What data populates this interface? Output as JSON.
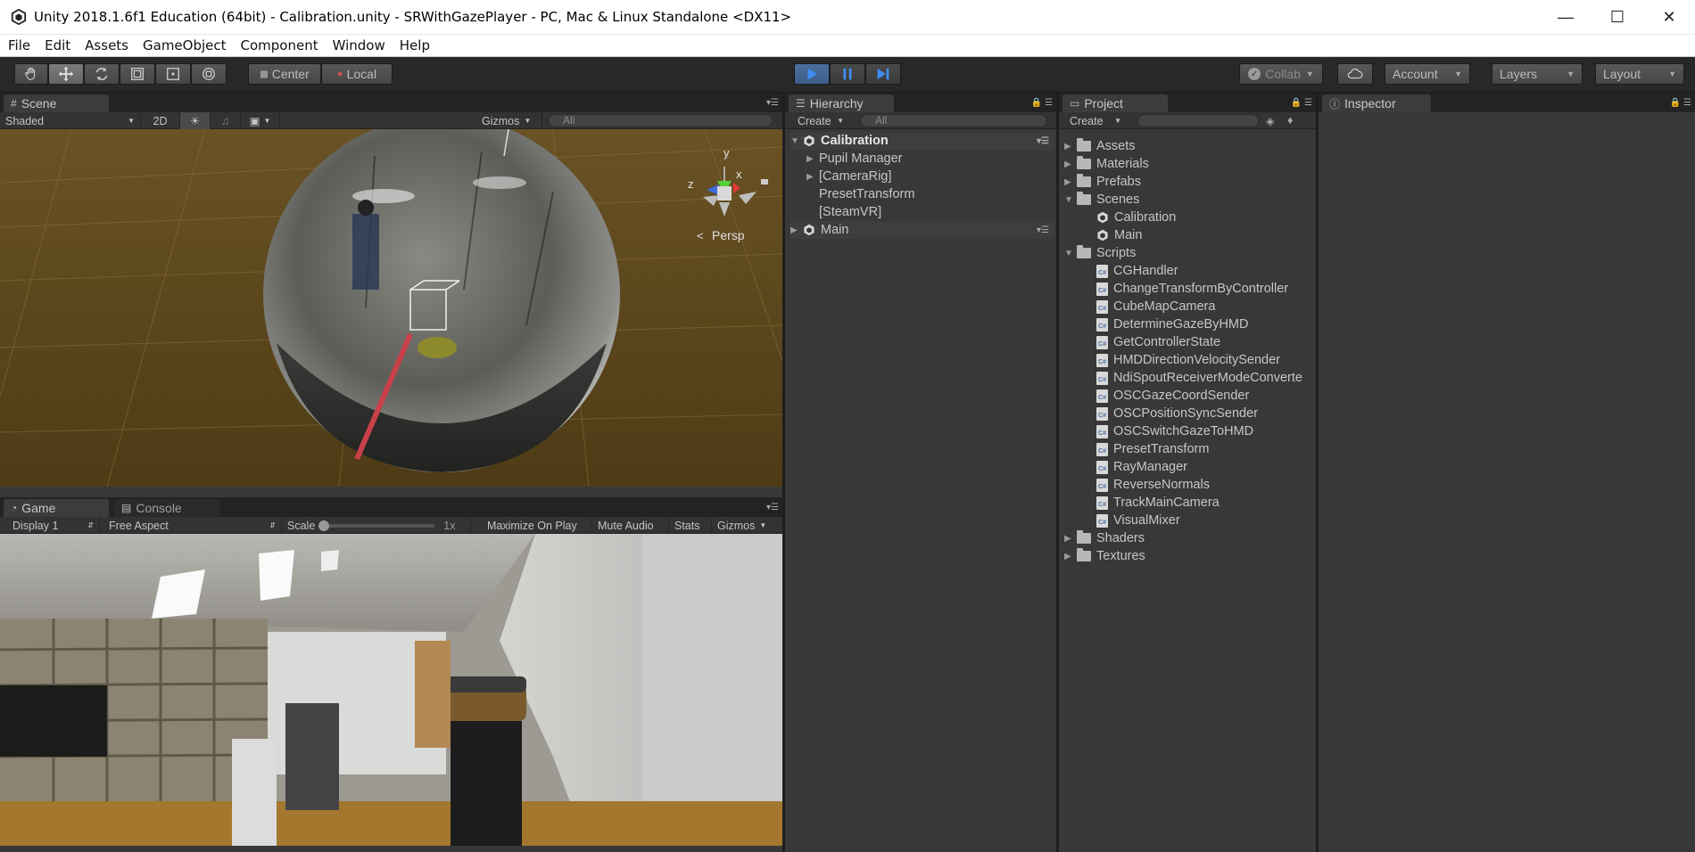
{
  "window": {
    "title": "Unity 2018.1.6f1 Education (64bit) - Calibration.unity - SRWithGazePlayer - PC, Mac & Linux Standalone <DX11>",
    "controls": [
      "—",
      "☐",
      "✕"
    ]
  },
  "menu": [
    "File",
    "Edit",
    "Assets",
    "GameObject",
    "Component",
    "Window",
    "Help"
  ],
  "toolbar": {
    "center_label": "Center",
    "local_label": "Local",
    "collab_label": "Collab",
    "account_label": "Account",
    "layers_label": "Layers",
    "layout_label": "Layout"
  },
  "scene": {
    "tab": "Scene",
    "shading": "Shaded",
    "mode_2d": "2D",
    "gizmos": "Gizmos",
    "search_placeholder": "All",
    "persp_label": "Persp",
    "axis_y": "y",
    "axis_x": "x",
    "axis_z": "z"
  },
  "game": {
    "tab_game": "Game",
    "tab_console": "Console",
    "display": "Display 1",
    "aspect": "Free Aspect",
    "scale_label": "Scale",
    "scale_value": "1x",
    "maximize": "Maximize On Play",
    "mute": "Mute Audio",
    "stats": "Stats",
    "gizmos": "Gizmos"
  },
  "hierarchy": {
    "tab": "Hierarchy",
    "create": "Create",
    "search_placeholder": "All",
    "items": [
      {
        "label": "Calibration"
      },
      {
        "label": "Pupil Manager"
      },
      {
        "label": "[CameraRig]"
      },
      {
        "label": "PresetTransform"
      },
      {
        "label": "[SteamVR]"
      },
      {
        "label": "Main"
      }
    ]
  },
  "project": {
    "tab": "Project",
    "create": "Create",
    "items": [
      {
        "label": "Assets"
      },
      {
        "label": "Materials"
      },
      {
        "label": "Prefabs"
      },
      {
        "label": "Scenes"
      },
      {
        "label": "Calibration"
      },
      {
        "label": "Main"
      },
      {
        "label": "Scripts"
      },
      {
        "label": "CGHandler"
      },
      {
        "label": "ChangeTransformByController"
      },
      {
        "label": "CubeMapCamera"
      },
      {
        "label": "DetermineGazeByHMD"
      },
      {
        "label": "GetControllerState"
      },
      {
        "label": "HMDDirectionVelocitySender"
      },
      {
        "label": "NdiSpoutReceiverModeConverte"
      },
      {
        "label": "OSCGazeCoordSender"
      },
      {
        "label": "OSCPositionSyncSender"
      },
      {
        "label": "OSCSwitchGazeToHMD"
      },
      {
        "label": "PresetTransform"
      },
      {
        "label": "RayManager"
      },
      {
        "label": "ReverseNormals"
      },
      {
        "label": "TrackMainCamera"
      },
      {
        "label": "VisualMixer"
      },
      {
        "label": "Shaders"
      },
      {
        "label": "Textures"
      }
    ]
  },
  "inspector": {
    "tab": "Inspector"
  }
}
